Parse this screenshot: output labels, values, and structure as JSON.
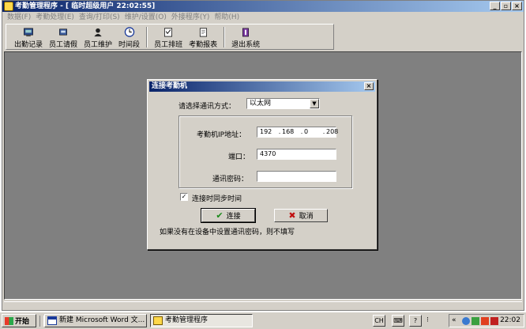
{
  "window": {
    "title": "考勤管理程序 - [ 临时超级用户 22:02:55]",
    "min": "_",
    "max": "▫",
    "close": "×"
  },
  "menu": [
    "数据(F)",
    "考勤处理(E)",
    "查询/打印(S)",
    "维护/设置(O)",
    "外接程序(Y)",
    "帮助(H)"
  ],
  "toolbar": {
    "items": [
      {
        "label": "出勤记录",
        "icon": "attendance-record-icon"
      },
      {
        "label": "员工请假",
        "icon": "employee-leave-icon"
      },
      {
        "label": "员工维护",
        "icon": "employee-maintenance-icon"
      },
      {
        "label": "时间段",
        "icon": "clock-icon"
      },
      {
        "label": "员工排班",
        "icon": "schedule-icon"
      },
      {
        "label": "考勤报表",
        "icon": "report-icon"
      },
      {
        "label": "退出系统",
        "icon": "exit-icon"
      }
    ]
  },
  "dialog": {
    "title": "连接考勤机",
    "close": "×",
    "comm_label": "请选择通讯方式：",
    "comm_value": "以太网",
    "ip_label": "考勤机IP地址：",
    "ip": [
      "192",
      "168",
      "0",
      "208"
    ],
    "ip_dot": ".",
    "port_label": "端口：",
    "port_value": "4370",
    "password_label": "通讯密码：",
    "password_value": "",
    "sync_label": "连接时同步时间",
    "sync_checked": "✓",
    "connect_label": "连接",
    "cancel_label": "取消",
    "hint": "如果没有在设备中设置通讯密码，则不填写"
  },
  "taskbar": {
    "start": "开始",
    "tasks": [
      "新建 Microsoft Word 文...",
      "考勤管理程序"
    ],
    "tray_buttons": [
      "CH",
      "?"
    ],
    "tray_arrows": "«",
    "clock": "22:02"
  },
  "colors": {
    "title_start": "#0a246a",
    "title_end": "#a6caf0",
    "face": "#d4d0c8",
    "client": "#808080"
  }
}
